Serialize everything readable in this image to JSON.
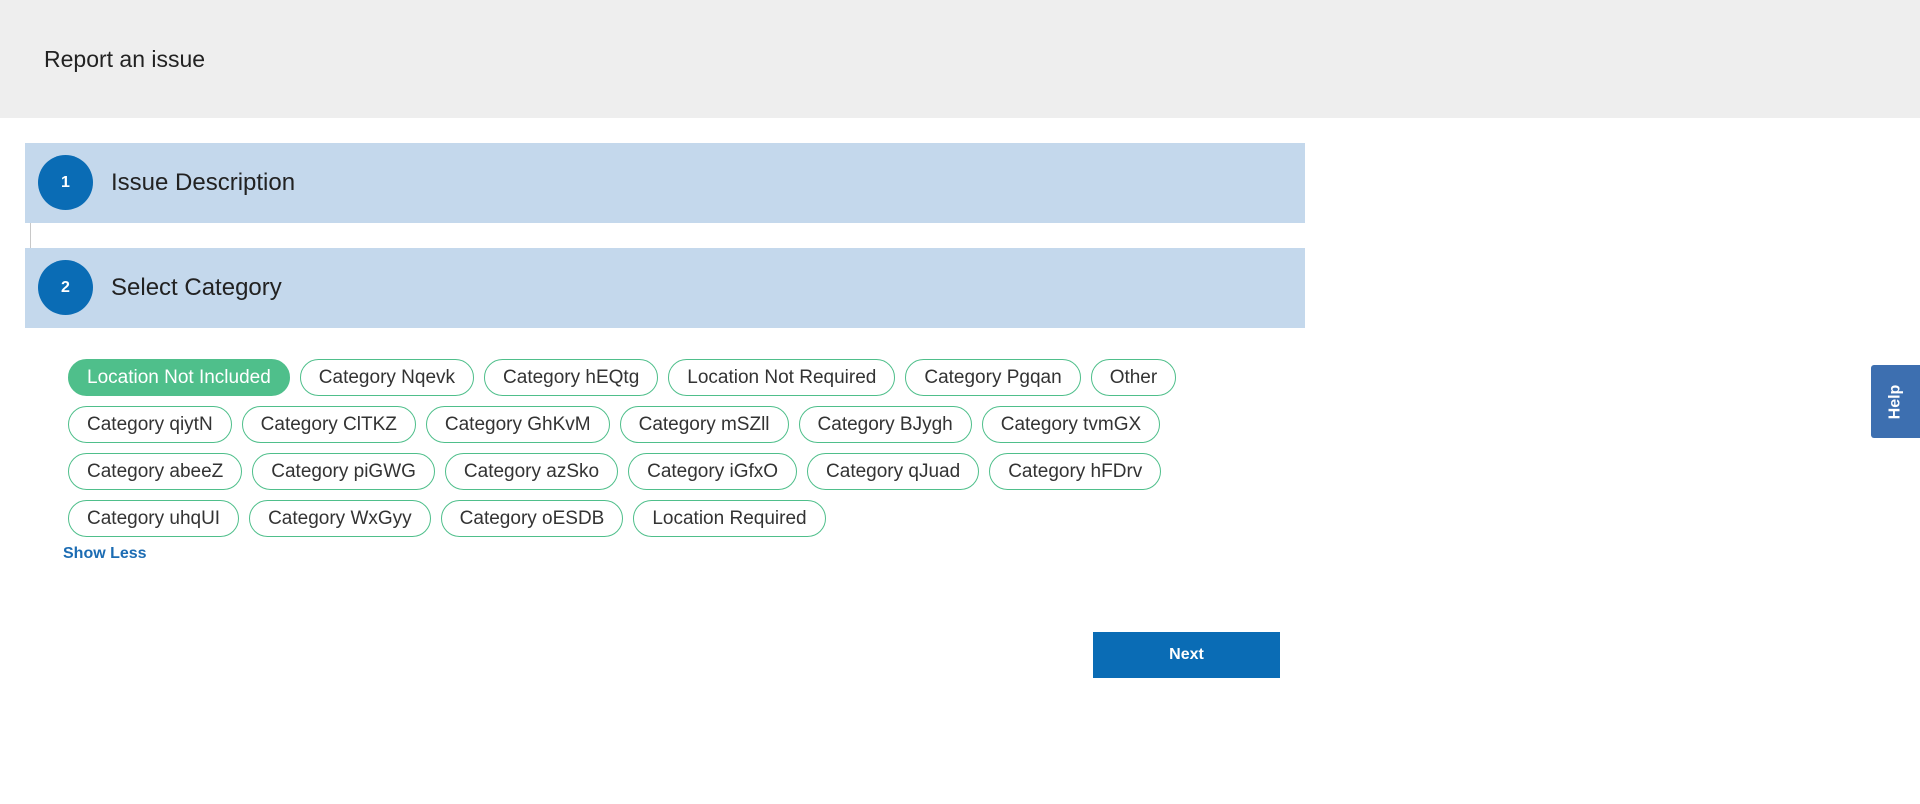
{
  "header": {
    "title": "Report an issue"
  },
  "steps": [
    {
      "number": "1",
      "title": "Issue Description"
    },
    {
      "number": "2",
      "title": "Select Category"
    }
  ],
  "categories": {
    "selected": "Location Not Included",
    "items": [
      "Location Not Included",
      "Category Nqevk",
      "Category hEQtg",
      "Location Not Required",
      "Category Pgqan",
      "Other",
      "Category qiytN",
      "Category ClTKZ",
      "Category GhKvM",
      "Category mSZll",
      "Category BJygh",
      "Category tvmGX",
      "Category abeeZ",
      "Category piGWG",
      "Category azSko",
      "Category iGfxO",
      "Category qJuad",
      "Category hFDrv",
      "Category uhqUI",
      "Category WxGyy",
      "Category oESDB",
      "Location Required"
    ],
    "show_less_label": "Show Less"
  },
  "actions": {
    "next_label": "Next"
  },
  "help": {
    "label": "Help"
  },
  "colors": {
    "accent": "#0a6cb5",
    "chip_border": "#4fbf8b",
    "step_header_bg": "#c4d8ec",
    "help_tab": "#3d6fb0"
  }
}
